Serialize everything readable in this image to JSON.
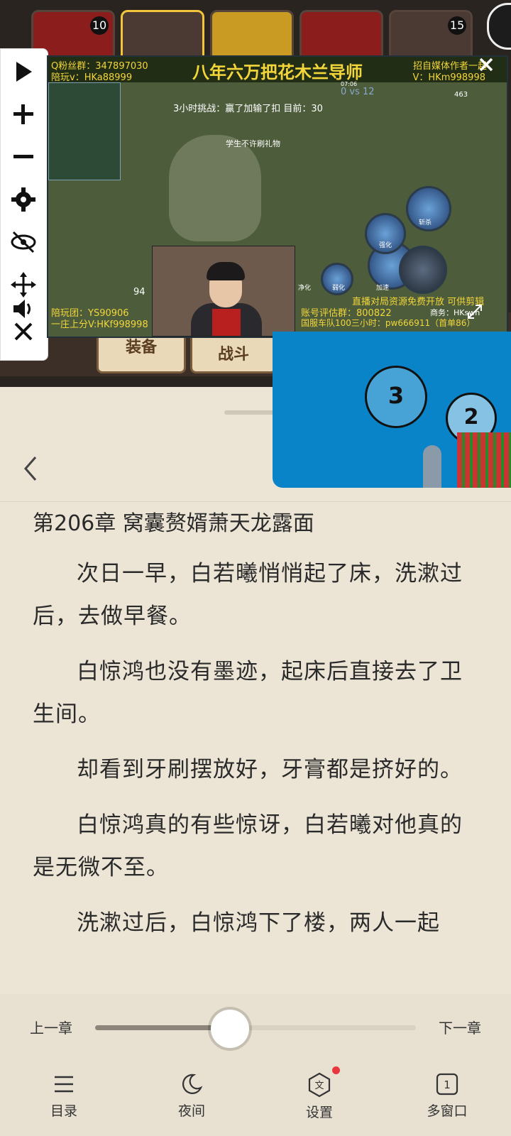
{
  "game_bg": {
    "tiles": [
      {
        "badge": "10"
      },
      {
        "badge": ""
      },
      {
        "badge": ""
      },
      {
        "badge": ""
      },
      {
        "badge": "15"
      }
    ],
    "slots": [
      {
        "label": "装备"
      },
      {
        "label": "战斗"
      }
    ]
  },
  "float_toolbar": {
    "icons": [
      "play-icon",
      "zoom-in-icon",
      "zoom-out-icon",
      "gear-icon",
      "eye-off-icon",
      "move-icon",
      "volume-icon",
      "close-icon"
    ]
  },
  "stream": {
    "title": "八年六万把花木兰导师",
    "tl_line1": "Q粉丝群：347897030",
    "tl_line2": "陪玩v：HKa88999",
    "tr_line1": "招自媒体作者一起",
    "tr_line2": "V：HKm998998",
    "challenge": "3小时挑战：赢了加输了扣 目前：30",
    "name_tag": "学生不许刷礼物",
    "score": "0 vs 12",
    "gold": "463",
    "time": "07:06",
    "hp": "94",
    "bl_line1": "陪玩团：YS90906",
    "bl_line2": "一庄上分V:HKf998998",
    "br_line1": "直播对局资源免费开放 可供剪辑",
    "br_line2": "账号评估群：800822",
    "br_line3": "国服车队100三小时：pw666911（首单86）",
    "br_line4": "商务：HKswh",
    "skills": [
      "斩杀",
      "强化",
      "加速",
      "弱化",
      "净化"
    ]
  },
  "mini_game": {
    "target_a": "3",
    "target_b": "2"
  },
  "reader": {
    "chapter_title": "第206章 窝囊赘婿萧天龙露面",
    "paragraphs": [
      "次日一早，白若曦悄悄起了床，洗漱过后，去做早餐。",
      "白惊鸿也没有墨迹，起床后直接去了卫生间。",
      "却看到牙刷摆放好，牙膏都是挤好的。",
      "白惊鸿真的有些惊讶，白若曦对他真的是无微不至。",
      "洗漱过后，白惊鸿下了楼，两人一起"
    ]
  },
  "progress": {
    "prev_label": "上一章",
    "next_label": "下一章",
    "value": 0.42
  },
  "tabbar": {
    "items": [
      {
        "label": "目录",
        "icon": "menu-icon"
      },
      {
        "label": "夜间",
        "icon": "moon-icon"
      },
      {
        "label": "设置",
        "icon": "text-settings-icon"
      },
      {
        "label": "多窗口",
        "icon": "window-count-icon",
        "count": "1"
      }
    ]
  },
  "colors": {
    "page_bg": "#ece5d6",
    "accent_yellow": "#f3d63a",
    "notify_red": "#e8383d",
    "mini_game_blue": "#0a84c9"
  }
}
